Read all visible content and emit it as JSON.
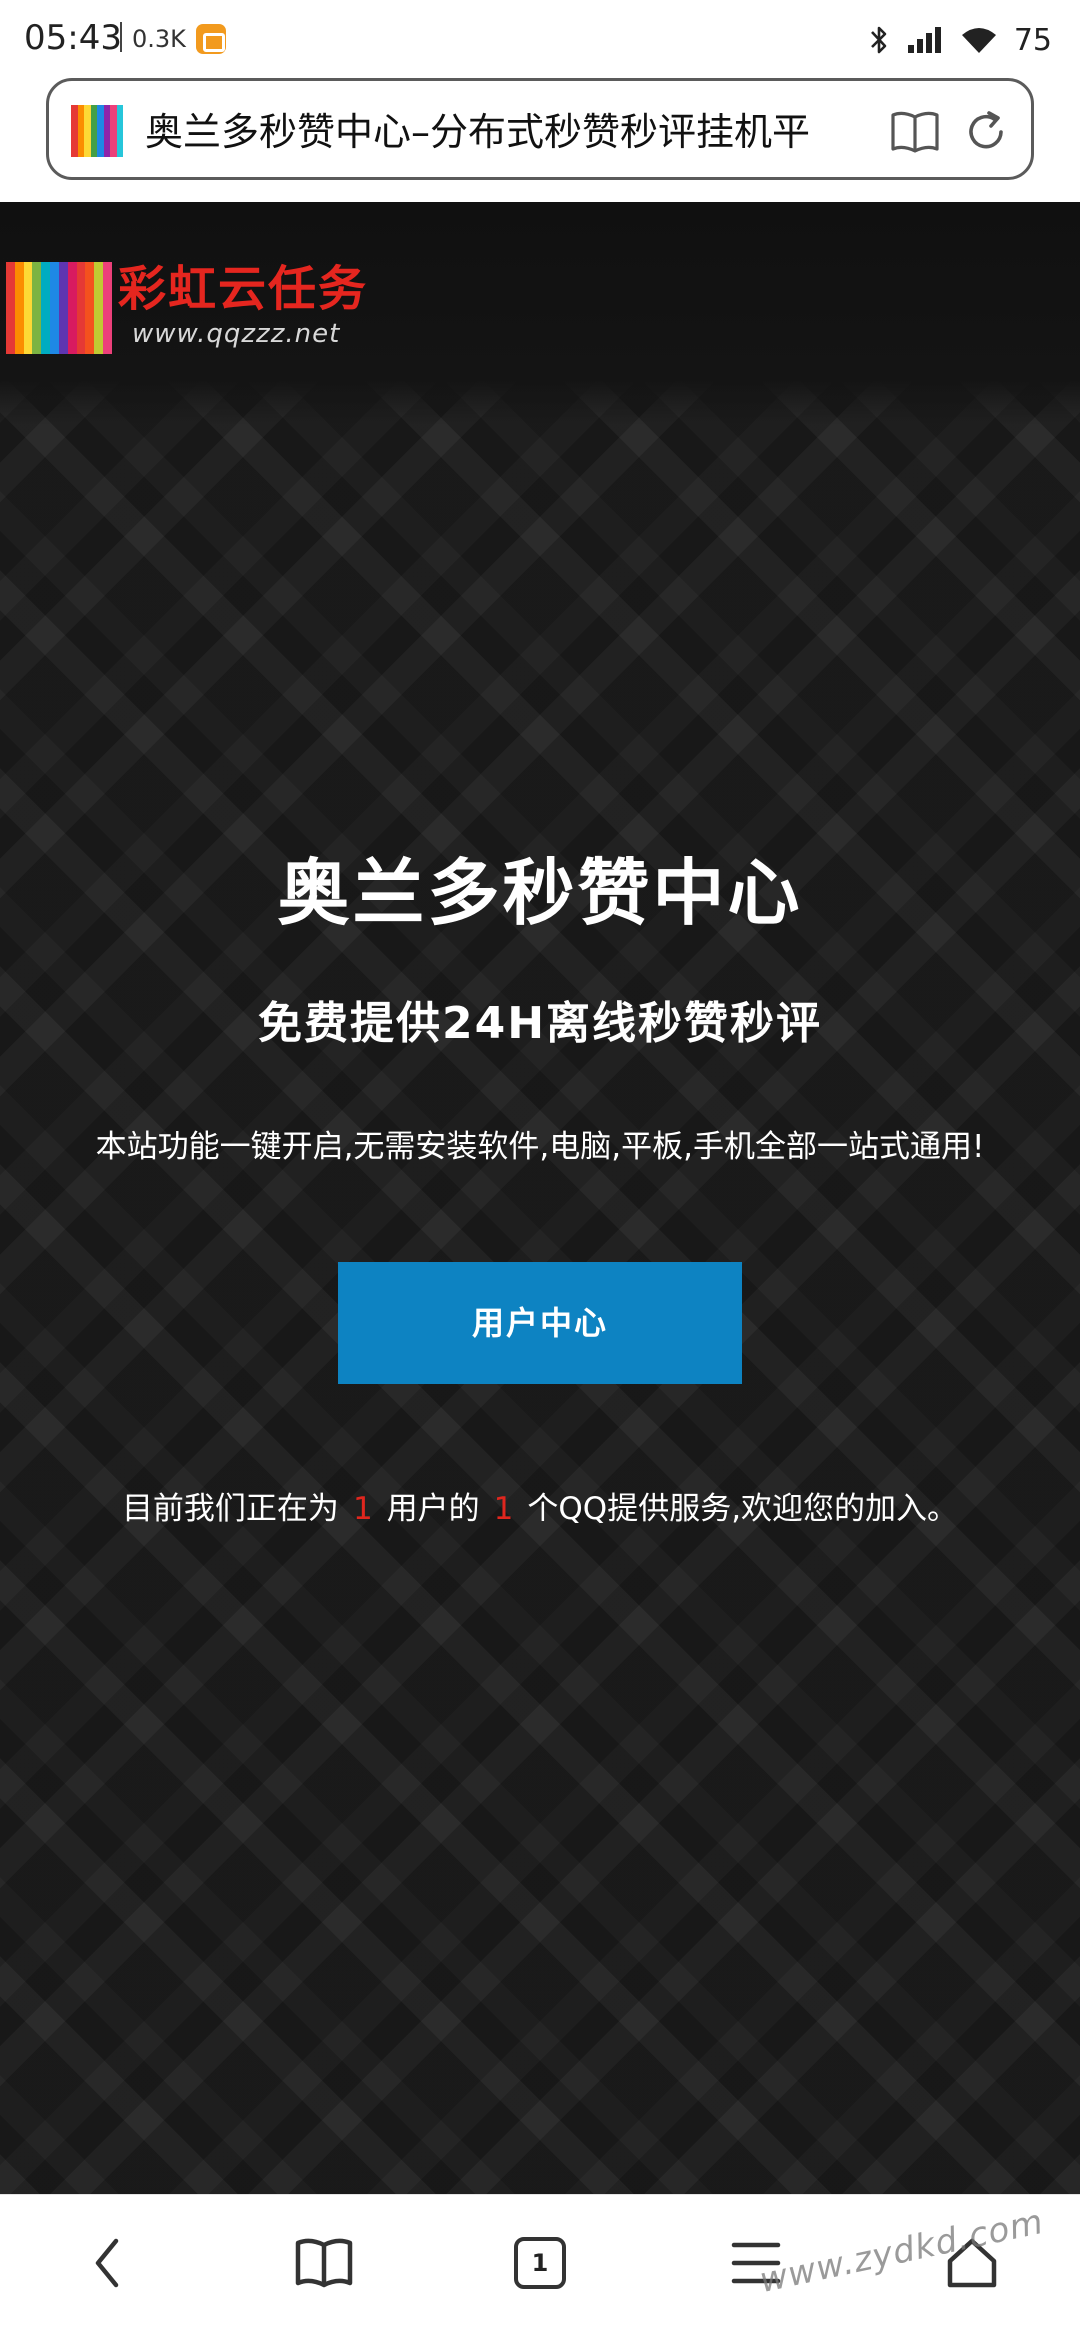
{
  "status_bar": {
    "time": "05:43",
    "net_speed": "0.3K",
    "battery": "75",
    "icons": [
      "bluetooth-icon",
      "signal-icon",
      "wifi-icon"
    ]
  },
  "browser": {
    "page_title": "奥兰多秒赞中心–分布式秒赞秒评挂机平",
    "tab_count": "1"
  },
  "site": {
    "logo_text": "彩虹云任务",
    "logo_url": "www.qqzzz.net",
    "hero_title": "奥兰多秒赞中心",
    "hero_subtitle": "免费提供24H离线秒赞秒评",
    "description": "本站功能一键开启,无需安装软件,电脑,平板,手机全部一站式通用!",
    "button_label": "用户中心",
    "stats": {
      "prefix": "目前我们正在为",
      "user_count": "1",
      "middle": "用户的",
      "qq_count": "1",
      "suffix": "个QQ提供服务,欢迎您的加入。"
    }
  },
  "watermark": "www.zydkd.com",
  "colors": {
    "accent_button": "#0d83c2",
    "highlight_number": "#e0261e",
    "logo_red": "#e5261f",
    "page_bg": "#1c1c1c"
  }
}
